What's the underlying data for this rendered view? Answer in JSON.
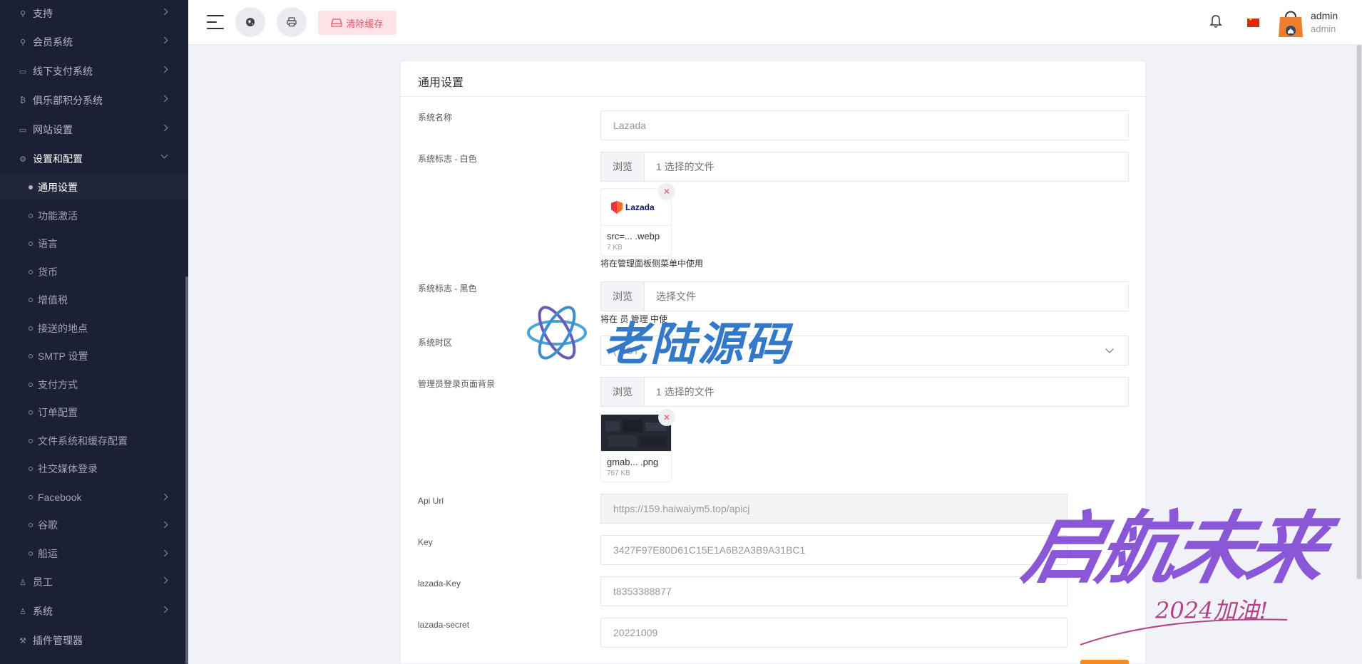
{
  "sidebar": {
    "items": [
      {
        "label": "支持",
        "icon": "link-icon"
      },
      {
        "label": "会员系统",
        "icon": "link-icon"
      },
      {
        "label": "线下支付系统",
        "icon": "money-icon"
      },
      {
        "label": "俱乐部积分系统",
        "icon": "bitcoin-icon"
      },
      {
        "label": "网站设置",
        "icon": "monitor-icon"
      },
      {
        "label": "设置和配置",
        "icon": "gear-icon"
      }
    ],
    "sub_items": [
      "通用设置",
      "功能激活",
      "语言",
      "货币",
      "增值税",
      "接送的地点",
      "SMTP 设置",
      "支付方式",
      "订单配置",
      "文件系统和缓存配置",
      "社交媒体登录",
      "Facebook",
      "谷歌",
      "船运"
    ],
    "bottom_items": [
      {
        "label": "员工",
        "icon": "user-icon"
      },
      {
        "label": "系统",
        "icon": "user-icon"
      },
      {
        "label": "插件管理器",
        "icon": "wrench-icon"
      }
    ]
  },
  "topbar": {
    "clear_cache_label": "清除缓存",
    "user_name": "admin",
    "user_role": "admin",
    "accent_color": "#e1566b"
  },
  "card": {
    "title": "通用设置",
    "fields": {
      "system_name_label": "系统名称",
      "system_name_value": "Lazada",
      "logo_white_label": "系统标志 - 白色",
      "browse_label": "浏览",
      "logo_white_file_text": "1 选择的文件",
      "logo_white_thumb_brand": "Lazada",
      "logo_white_thumb_name": "src=... .webp",
      "logo_white_thumb_size": "7 KB",
      "logo_white_hint": "将在管理面板侧菜单中使用",
      "logo_black_label": "系统标志 - 黑色",
      "logo_black_file_text": "选择文件",
      "logo_black_hint": "将在 员 管理 中使",
      "timezone_label": "系统时区",
      "timezone_value": "(     ) GT",
      "admin_bg_label": "管理员登录页面背景",
      "admin_bg_file_text": "1 选择的文件",
      "admin_bg_thumb_name": "gmab... .png",
      "admin_bg_thumb_size": "767 KB",
      "api_url_label": "Api Url",
      "api_url_value": "https://159.haiwaiym5.top/apicj",
      "key_label": "Key",
      "key_value": "3427F97E80D61C15E1A6B2A3B9A31BC1",
      "lazada_key_label": "lazada-Key",
      "lazada_key_value": "t8353388877",
      "lazada_secret_label": "lazada-secret",
      "lazada_secret_value": "20221009"
    }
  },
  "watermarks": {
    "wm1_text": "老陆源码",
    "wm2_text": "启航未来",
    "wm2_sub": "2024加油!"
  }
}
